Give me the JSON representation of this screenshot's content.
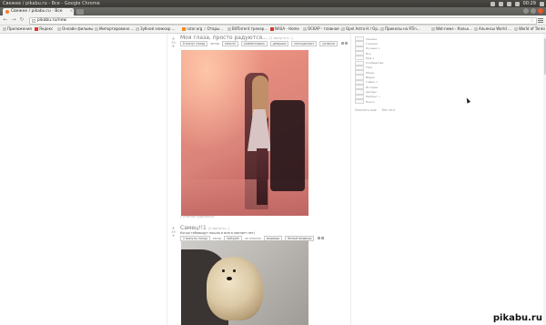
{
  "window": {
    "title": "Свежее / pikabu.ru - Все - Google Chrome",
    "clock": "00:29"
  },
  "tab": {
    "title": "Свежее / pikabu.ru - Все",
    "close": "×"
  },
  "toolbar": {
    "back": "←",
    "forward": "→",
    "reload": "↻",
    "url": "pikabu.ru/new",
    "star": "☆"
  },
  "bookmarks": [
    {
      "label": "Приложения",
      "icon": "apps-icon"
    },
    {
      "label": "Яндекс",
      "icon": "yandex-icon"
    },
    {
      "label": "Онлайн фильмы",
      "icon": "folder-icon"
    },
    {
      "label": "Импортировано ...",
      "icon": "folder-icon"
    },
    {
      "label": "Зубной эликсир ...",
      "icon": "page-icon"
    },
    {
      "label": "rutor.org :: Отары...",
      "icon": "rutor-icon"
    },
    {
      "label": "BitTorrent трекер...",
      "icon": "page-icon"
    },
    {
      "label": "NASA - Home",
      "icon": "nasa-icon"
    },
    {
      "label": "OCKAP - главная ...",
      "icon": "page-icon"
    },
    {
      "label": "Opel Astra H / Op...",
      "icon": "page-icon"
    },
    {
      "label": "Приколы на RTin...",
      "icon": "page-icon"
    },
    {
      "label": "Wot-news - Кальк...",
      "icon": "page-icon"
    },
    {
      "label": "Альянсы World ...",
      "icon": "page-icon"
    },
    {
      "label": "World of Tanks",
      "icon": "wot-icon"
    }
  ],
  "stories": [
    {
      "title": "Моя глаза, просто радуются...",
      "age": "(1 минута н...)",
      "rating": "29",
      "meta": [
        "8 минут назад",
        "автор",
        "slavichi",
        "комментарии",
        "девушки",
        "мотоциклист",
        "коляска"
      ],
      "footer": [
        "0 ответов",
        "поделиться"
      ]
    },
    {
      "title": "Самец!!1",
      "age": "(2 минуты...)",
      "rating": "39",
      "subtitle": "Когда тебявыдут пошли и всего хватает нет)",
      "meta": [
        "2 минуты назад",
        "автор",
        "kottypet",
        "не смешно",
        "медведь",
        "белый медведь"
      ]
    }
  ],
  "sidebar": {
    "items": [
      {
        "label": "Свежее",
        "count": ""
      },
      {
        "label": "Горячее",
        "count": ""
      },
      {
        "label": "Лучшее",
        "count": "4"
      },
      {
        "label": "Все",
        "count": ""
      },
      {
        "label": "Моё",
        "count": "4"
      },
      {
        "label": "Сообщества",
        "count": ""
      },
      {
        "label": "Теги",
        "count": ""
      },
      {
        "label": "Юмор",
        "count": ""
      },
      {
        "label": "Видео",
        "count": ""
      },
      {
        "label": "Гифки",
        "count": "3"
      },
      {
        "label": "Истории",
        "count": ""
      },
      {
        "label": "Авторы",
        "count": ""
      },
      {
        "label": "Рейтинг",
        "count": "1"
      },
      {
        "label": "Поиск",
        "count": ""
      }
    ],
    "links": [
      "Показать еще",
      "Все теги"
    ]
  },
  "watermark": "pikabu.ru"
}
